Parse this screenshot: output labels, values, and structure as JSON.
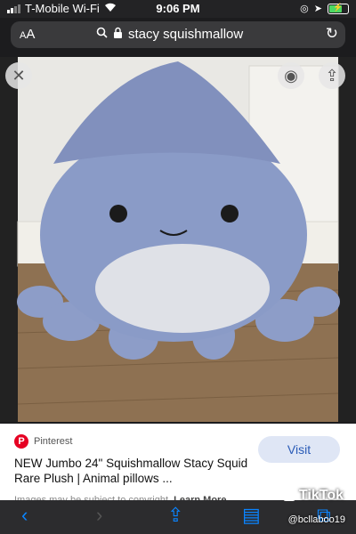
{
  "status_bar": {
    "carrier": "T-Mobile Wi-Fi",
    "time": "9:06 PM",
    "signal_icon": "signal-bars-icon",
    "wifi_icon": "wifi-icon",
    "location_icon": "location-arrow-icon",
    "battery_icon": "battery-charging-icon",
    "battery_color": "#4cd964"
  },
  "url_bar": {
    "aa_label_big": "A",
    "aa_label_small": "A",
    "query": "stacy squishmallow",
    "search_icon": "search-icon",
    "lock_icon": "lock-icon",
    "reload_icon": "reload-icon"
  },
  "image_viewer": {
    "close_icon": "close-icon",
    "lens_icon": "lens-search-icon",
    "share_icon": "share-icon"
  },
  "result_card": {
    "source_name": "Pinterest",
    "source_icon": "pinterest-icon",
    "title": "NEW Jumbo 24\" Squishmallow Stacy Squid Rare Plush | Animal pillows ...",
    "copyright_text": "Images may be subject to copyright.",
    "learn_more": "Learn More",
    "visit_label": "Visit"
  },
  "toolbar": {
    "back_icon": "back-arrow-icon",
    "forward_icon": "forward-arrow-icon",
    "share_icon": "share-icon",
    "bookmarks_icon": "bookmarks-icon",
    "tabs_icon": "tabs-icon"
  },
  "watermark": {
    "app_name": "TikTok",
    "handle": "@bcllaboo19"
  }
}
